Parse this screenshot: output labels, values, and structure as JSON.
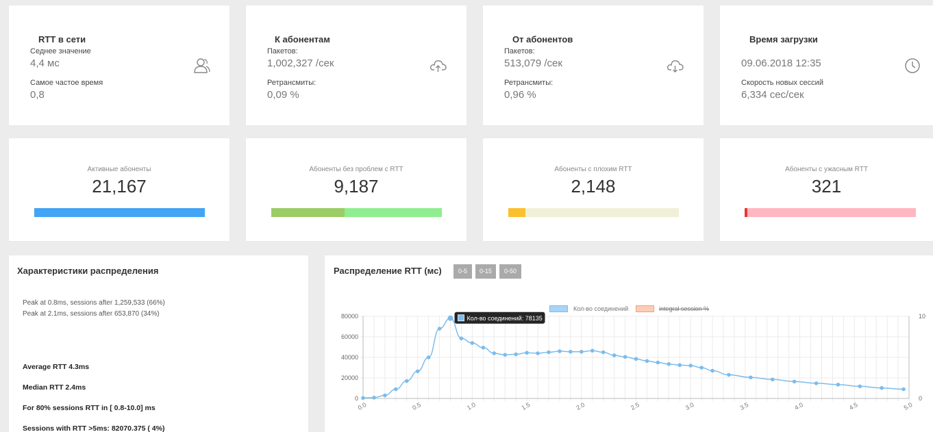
{
  "stats": [
    {
      "title": "RTT в сети",
      "label1": "Седнее значение",
      "value1": "4,4 мс",
      "label2": "Самое частое время",
      "value2": "0,8",
      "icon": "users-icon"
    },
    {
      "title": "К абонентам",
      "label1": "Пакетов:",
      "value1": "1,002,327 /сек",
      "label2": "Ретрансмиты:",
      "value2": "0,09 %",
      "icon": "cloud-upload-icon"
    },
    {
      "title": "От абонентов",
      "label1": "Пакетов:",
      "value1": "513,079 /сек",
      "label2": "Ретрансмиты:",
      "value2": "0,96 %",
      "icon": "cloud-download-icon"
    },
    {
      "title": "Время загрузки",
      "label1": "",
      "value1": "09.06.2018 12:35",
      "label2": "Скорость новых сессий",
      "value2": "6,334 сес/сек",
      "icon": "clock-icon"
    }
  ],
  "subscribers": [
    {
      "label": "Активные абоненты",
      "value": "21,167",
      "fill": 1.0,
      "colors": [
        "#42a5f5",
        "#42a5f5"
      ]
    },
    {
      "label": "Абоненты без проблем с RTT",
      "value": "9,187",
      "fill": 0.43,
      "colors": [
        "#9ccc65",
        "#90ee90"
      ]
    },
    {
      "label": "Абоненты с плохим RTT",
      "value": "2,148",
      "fill": 0.1,
      "colors": [
        "#fbc02d",
        "#f0f0d8"
      ]
    },
    {
      "label": "Абоненты с ужасным RTT",
      "value": "321",
      "fill": 0.015,
      "colors": [
        "#e53935",
        "#ffb6c1"
      ]
    }
  ],
  "distribution_stats": {
    "title": "Характеристики распределения",
    "peaks": [
      "Peak at 0.8ms, sessions after 1,259,533 (66%)",
      "Peak at 2.1ms, sessions after 653,870 (34%)"
    ],
    "metrics": [
      "Average RTT 4.3ms",
      "Median RTT 2.4ms",
      "For 80% sessions RTT in [ 0.8-10.0] ms",
      "Sessions with RTT >5ms: 82070.375 ( 4%)"
    ]
  },
  "rtt_chart_panel": {
    "title": "Распределение RTT (мс)",
    "range_buttons": [
      "0-5",
      "0-15",
      "0-50"
    ],
    "legend": [
      {
        "label": "Кол-во соединений",
        "color": "#a8d4f5",
        "border": "#7cbcec",
        "struck": false
      },
      {
        "label": "integral session %",
        "color": "#fbcdb7",
        "border": "#f0a080",
        "struck": true
      }
    ],
    "tooltip": "Кол-во соединений: 78135",
    "tooltip_swatch": "#7cbcec"
  },
  "chart_data": {
    "type": "line",
    "series": [
      {
        "name": "Кол-во соединений",
        "x": [
          0,
          0.1,
          0.2,
          0.3,
          0.4,
          0.5,
          0.6,
          0.7,
          0.8,
          0.9,
          1.0,
          1.1,
          1.2,
          1.3,
          1.4,
          1.5,
          1.6,
          1.7,
          1.8,
          1.9,
          2.0,
          2.1,
          2.2,
          2.3,
          2.4,
          2.5,
          2.6,
          2.7,
          2.8,
          2.9,
          3.0,
          3.1,
          3.2,
          3.35,
          3.55,
          3.75,
          3.95,
          4.15,
          4.35,
          4.55,
          4.75,
          4.95
        ],
        "y": [
          500,
          800,
          3000,
          9000,
          17000,
          26500,
          40000,
          68000,
          78135,
          58500,
          54000,
          49500,
          44000,
          42500,
          43000,
          44500,
          44000,
          45000,
          46000,
          45500,
          45500,
          46500,
          45000,
          42000,
          40500,
          38500,
          36500,
          35000,
          33500,
          32500,
          32000,
          30000,
          27000,
          23000,
          20500,
          18500,
          16500,
          14800,
          13500,
          11800,
          10200,
          9000
        ],
        "color": "#7cbcec"
      }
    ],
    "xlim": [
      0,
      5.0
    ],
    "ylim": [
      0,
      80000
    ],
    "y2lim": [
      0,
      10
    ],
    "x_ticks": [
      "0.0",
      "0.5",
      "1.0",
      "1.5",
      "2.0",
      "2.5",
      "3.0",
      "3.5",
      "4.0",
      "4.5",
      "5.0"
    ],
    "y_ticks": [
      "0",
      "20000",
      "40000",
      "60000",
      "80000"
    ],
    "y2_ticks": [
      "0",
      "10"
    ],
    "grid": true
  }
}
